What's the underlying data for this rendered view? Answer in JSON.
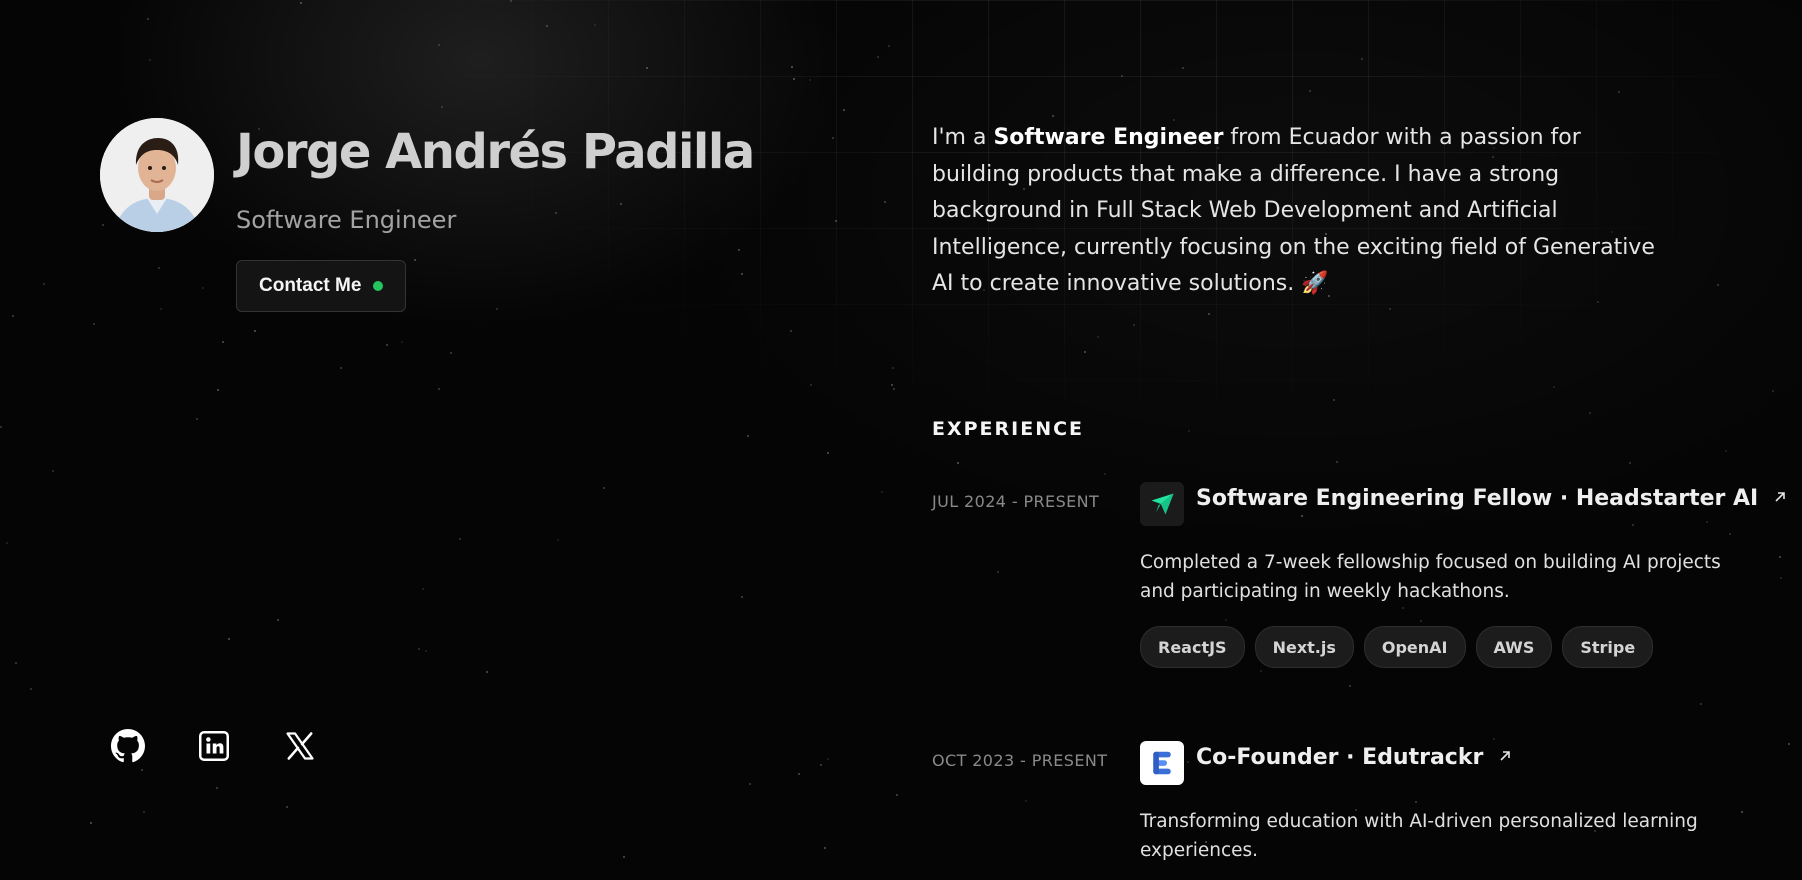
{
  "profile": {
    "name": "Jorge Andrés Padilla",
    "role": "Software Engineer",
    "contact_label": "Contact Me",
    "status_color": "#22c55e"
  },
  "about": {
    "prefix": "I'm a ",
    "highlight": "Software Engineer",
    "suffix": " from Ecuador with a passion for building products that make a difference. I have a strong background in Full Stack Web Development and Artificial Intelligence, currently focusing on the exciting field of Generative AI to create innovative solutions. 🚀"
  },
  "experience": {
    "title": "EXPERIENCE",
    "items": [
      {
        "date": "JUL 2024 - PRESENT",
        "title": "Software Engineering Fellow · Headstarter AI",
        "logo": "headstarter-logo",
        "description": "Completed a 7-week fellowship focused on building AI projects and participating in weekly hackathons.",
        "tags": [
          "ReactJS",
          "Next.js",
          "OpenAI",
          "AWS",
          "Stripe"
        ]
      },
      {
        "date": "OCT 2023 - PRESENT",
        "title": "Co-Founder · Edutrackr",
        "logo": "edutrackr-logo",
        "description": "Transforming education with AI-driven personalized learning experiences.",
        "tags": []
      }
    ]
  },
  "social": [
    {
      "icon": "github-icon"
    },
    {
      "icon": "linkedin-icon"
    },
    {
      "icon": "x-icon"
    }
  ],
  "colors": {
    "background": "#050505",
    "accent_green": "#22c55e",
    "headstarter_green": "#22e3a0",
    "edutrackr_blue": "#3b6fd8"
  }
}
